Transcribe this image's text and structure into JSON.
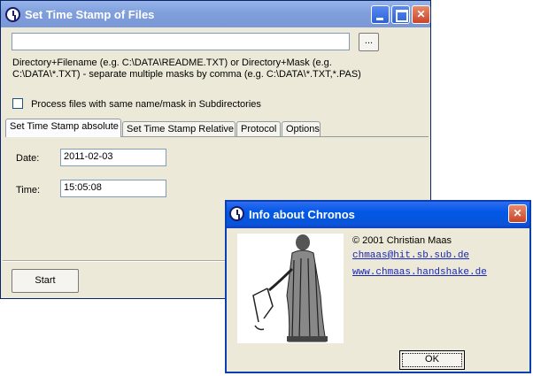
{
  "main_window": {
    "title": "Set Time Stamp of Files",
    "path_value": "",
    "browse_label": "...",
    "hint_line1": "Directory+Filename (e.g. C:\\DATA\\README.TXT) or Directory+Mask (e.g.",
    "hint_line2": "C:\\DATA\\*.TXT) - separate multiple masks by comma (e.g. C:\\DATA\\*.TXT,*.PAS)",
    "subdir_label": "Process files with same name/mask in Subdirectories",
    "tabs": [
      {
        "label": "Set Time Stamp absolute",
        "active": true
      },
      {
        "label": "Set Time Stamp Relative"
      },
      {
        "label": "Protocol"
      },
      {
        "label": "Options"
      }
    ],
    "date_label": "Date:",
    "date_value": "2011-02-03",
    "time_label": "Time:",
    "time_value": "15:05:08",
    "start_label": "Start"
  },
  "info_window": {
    "title": "Info about Chronos",
    "copyright": "© 2001 Christian Maas",
    "email": "chmaas@hit.sb.sub.de",
    "website": "www.chmaas.handshake.de",
    "ok_label": "OK"
  },
  "icons": {
    "app": "chronos-app-icon",
    "minimize": "minimize-icon",
    "maximize": "maximize-icon",
    "close": "close-icon"
  },
  "colors": {
    "inactive_titlebar": "#7f9fdb",
    "active_titlebar": "#0058e6",
    "window_face": "#ece9d8",
    "link": "#1a26b4",
    "close_button": "#c9442a"
  }
}
